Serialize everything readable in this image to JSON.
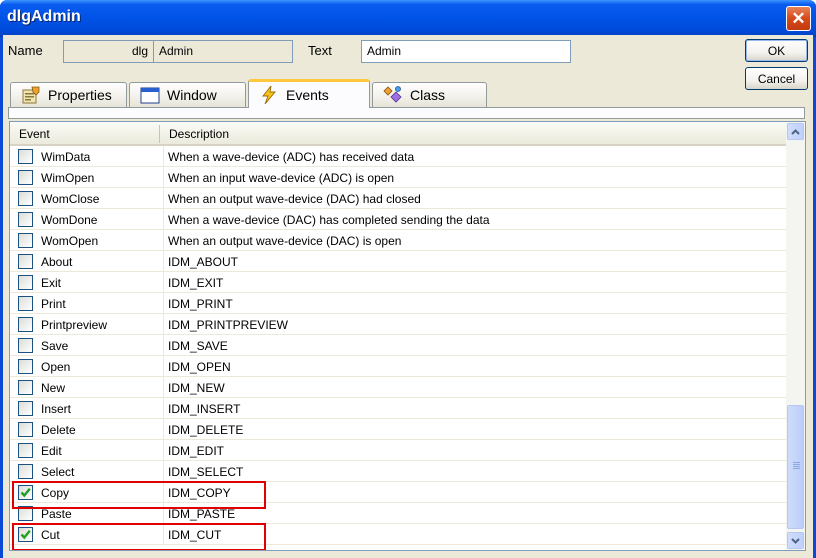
{
  "window": {
    "title": "dlgAdmin",
    "close_glyph": "✕"
  },
  "form": {
    "name_label": "Name",
    "name_prefix": "dlg",
    "name_value": "Admin",
    "text_label": "Text",
    "text_value": "Admin"
  },
  "buttons": {
    "ok": "OK",
    "cancel": "Cancel"
  },
  "tabs": [
    {
      "label": "Properties",
      "icon": "properties-icon"
    },
    {
      "label": "Window",
      "icon": "window-icon"
    },
    {
      "label": "Events",
      "icon": "lightning-icon",
      "active": true
    },
    {
      "label": "Class",
      "icon": "class-icon"
    }
  ],
  "grid": {
    "headers": {
      "event": "Event",
      "description": "Description"
    },
    "rows": [
      {
        "event": "WimData",
        "description": "When a wave-device (ADC) has received data",
        "checked": false
      },
      {
        "event": "WimOpen",
        "description": "When an input wave-device (ADC) is open",
        "checked": false
      },
      {
        "event": "WomClose",
        "description": "When an output wave-device (DAC) had closed",
        "checked": false
      },
      {
        "event": "WomDone",
        "description": "When a wave-device (DAC) has completed sending the data",
        "checked": false
      },
      {
        "event": "WomOpen",
        "description": "When an output wave-device (DAC) is open",
        "checked": false
      },
      {
        "event": "About",
        "description": "IDM_ABOUT",
        "checked": false
      },
      {
        "event": "Exit",
        "description": "IDM_EXIT",
        "checked": false
      },
      {
        "event": "Print",
        "description": "IDM_PRINT",
        "checked": false
      },
      {
        "event": "Printpreview",
        "description": "IDM_PRINTPREVIEW",
        "checked": false
      },
      {
        "event": "Save",
        "description": "IDM_SAVE",
        "checked": false
      },
      {
        "event": "Open",
        "description": "IDM_OPEN",
        "checked": false
      },
      {
        "event": "New",
        "description": "IDM_NEW",
        "checked": false
      },
      {
        "event": "Insert",
        "description": "IDM_INSERT",
        "checked": false
      },
      {
        "event": "Delete",
        "description": "IDM_DELETE",
        "checked": false
      },
      {
        "event": "Edit",
        "description": "IDM_EDIT",
        "checked": false
      },
      {
        "event": "Select",
        "description": "IDM_SELECT",
        "checked": false
      },
      {
        "event": "Copy",
        "description": "IDM_COPY",
        "checked": true,
        "highlighted": true
      },
      {
        "event": "Paste",
        "description": "IDM_PASTE",
        "checked": false
      },
      {
        "event": "Cut",
        "description": "IDM_CUT",
        "checked": true,
        "highlighted": true
      }
    ]
  },
  "colors": {
    "highlight": "#e00000",
    "check": "#21a121",
    "titlebar": "#0053e6"
  }
}
